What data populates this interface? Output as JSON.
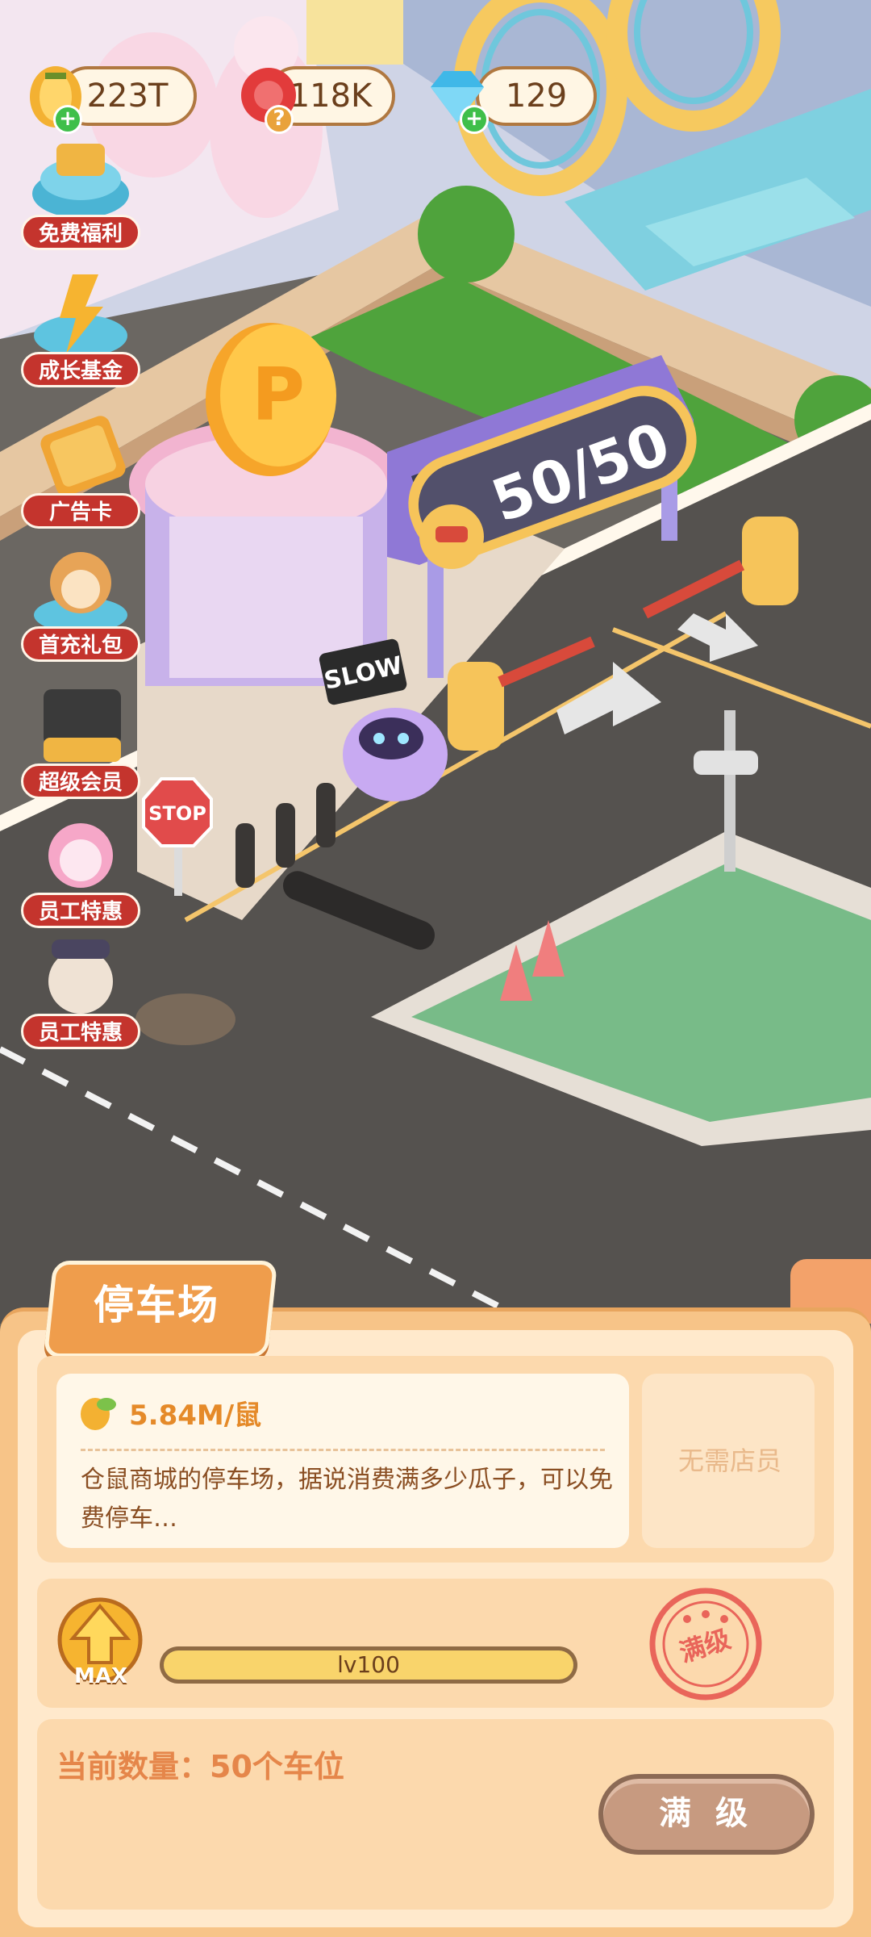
{
  "currencies": {
    "seeds": "223T",
    "gems_red": "118K",
    "diamonds": "129"
  },
  "side_menu": [
    {
      "label": "免费福利",
      "icon": "coin-pile-icon"
    },
    {
      "label": "成长基金",
      "icon": "lightning-coins-icon"
    },
    {
      "label": "广告卡",
      "icon": "ad-card-icon"
    },
    {
      "label": "首充礼包",
      "icon": "hamster-gift-icon"
    },
    {
      "label": "超级会员",
      "icon": "vip-card-icon"
    },
    {
      "label": "员工特惠",
      "icon": "pink-cat-icon"
    },
    {
      "label": "员工特惠",
      "icon": "hamster-hat-icon"
    }
  ],
  "scene": {
    "capacity_sign": "50/50",
    "slow_sign": "SLOW",
    "stop_sign": "STOP",
    "parking_sign": "P"
  },
  "panel": {
    "title": "停车场",
    "income": "5.84M/鼠",
    "description": "仓鼠商城的停车场，据说消费满多少瓜子，可以免费停车…",
    "no_staff": "无需店员",
    "level_badge": "MAX",
    "level_text": "lv100",
    "level_progress": 1.0,
    "stamp": "满级",
    "quantity_label": "当前数量：50个车位",
    "max_button": "满 级"
  }
}
